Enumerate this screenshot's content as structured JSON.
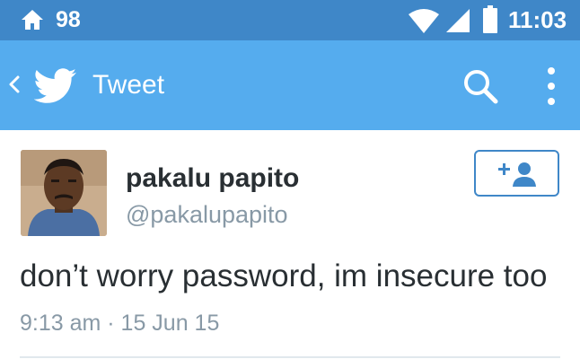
{
  "status_bar": {
    "notification_count": "98",
    "time": "11:03",
    "icons": [
      "home-icon",
      "wifi-icon",
      "cell-signal-icon",
      "battery-icon"
    ]
  },
  "action_bar": {
    "title": "Tweet",
    "icons": [
      "back-chevron-icon",
      "twitter-bird-icon",
      "search-icon",
      "overflow-menu-icon"
    ]
  },
  "tweet": {
    "user_name": "pakalu papito",
    "handle": "@pakalupapito",
    "text": "don’t worry password, im insecure too",
    "meta": "9:13 am · 15 Jun 15",
    "follow_icon": "add-user-icon"
  },
  "colors": {
    "status_bar": "#3f87c8",
    "action_bar": "#55acee",
    "accent": "#3f87c8",
    "name_text": "#292f33",
    "secondary_text": "#8899a6"
  }
}
